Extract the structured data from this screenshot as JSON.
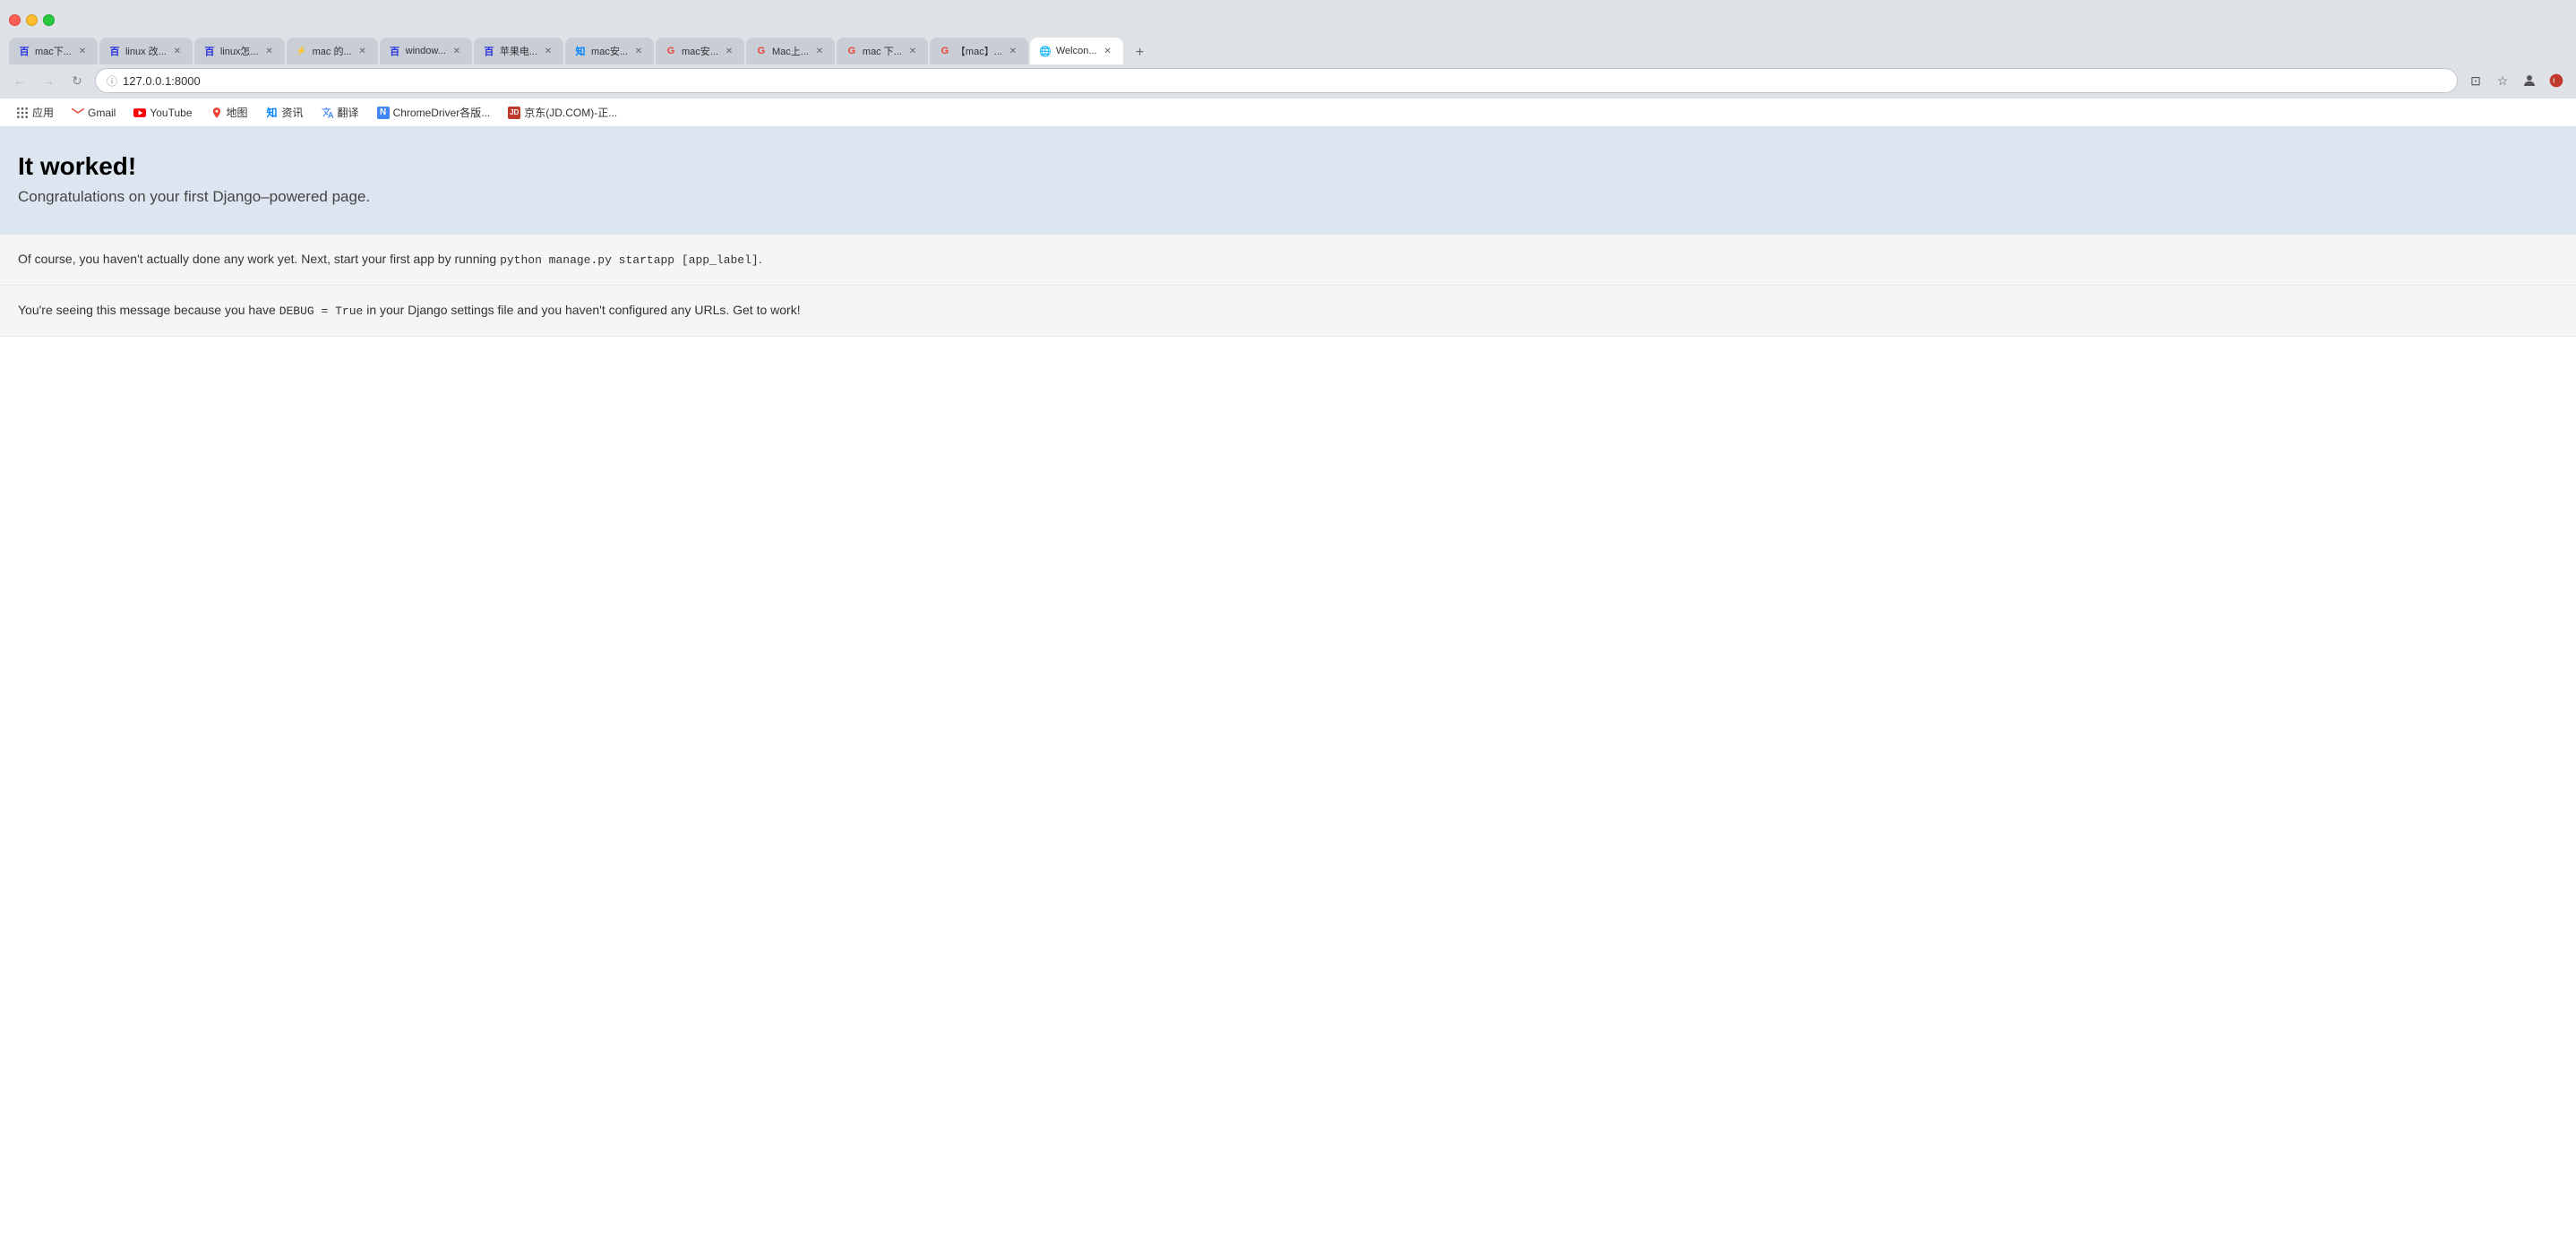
{
  "browser": {
    "url": "127.0.0.1:8000",
    "tabs": [
      {
        "id": "tab1",
        "label": "mac下...",
        "favicon_type": "baidu",
        "favicon_char": "百",
        "active": false
      },
      {
        "id": "tab2",
        "label": "linux 改...",
        "favicon_type": "baidu",
        "favicon_char": "百",
        "active": false
      },
      {
        "id": "tab3",
        "label": "linux怎...",
        "favicon_type": "baidu",
        "favicon_char": "百",
        "active": false
      },
      {
        "id": "tab4",
        "label": "mac 的...",
        "favicon_type": "tab-icon",
        "favicon_char": "⚡",
        "active": false
      },
      {
        "id": "tab5",
        "label": "window...",
        "favicon_type": "baidu",
        "favicon_char": "百",
        "active": false
      },
      {
        "id": "tab6",
        "label": "苹果电...",
        "favicon_type": "baidu",
        "favicon_char": "百",
        "active": false
      },
      {
        "id": "tab7",
        "label": "mac安...",
        "favicon_type": "zhihu",
        "favicon_char": "知",
        "active": false
      },
      {
        "id": "tab8",
        "label": "mac安...",
        "favicon_type": "google-red",
        "favicon_char": "G",
        "active": false
      },
      {
        "id": "tab9",
        "label": "Mac上...",
        "favicon_type": "google-red",
        "favicon_char": "G",
        "active": false
      },
      {
        "id": "tab10",
        "label": "mac 下...",
        "favicon_type": "google-red",
        "favicon_char": "G",
        "active": false
      },
      {
        "id": "tab11",
        "label": "【mac】...",
        "favicon_type": "google-red",
        "favicon_char": "G",
        "active": false
      },
      {
        "id": "tab12",
        "label": "Welcon...",
        "favicon_type": "globe",
        "favicon_char": "🌐",
        "active": true
      }
    ],
    "bookmarks": [
      {
        "label": "应用",
        "favicon_char": "⋮⋮",
        "type": "apps"
      },
      {
        "label": "Gmail",
        "favicon_char": "M",
        "type": "gmail"
      },
      {
        "label": "YouTube",
        "favicon_char": "▶",
        "type": "youtube"
      },
      {
        "label": "地图",
        "favicon_char": "📍",
        "type": "map"
      },
      {
        "label": "资讯",
        "favicon_char": "📰",
        "type": "news"
      },
      {
        "label": "翻译",
        "favicon_char": "🔤",
        "type": "translate"
      },
      {
        "label": "ChromeDriver各版...",
        "favicon_char": "N",
        "type": "chrome"
      },
      {
        "label": "京东(JD.COM)-正...",
        "favicon_char": "JD",
        "type": "jd"
      }
    ]
  },
  "page": {
    "hero_title": "It worked!",
    "hero_subtitle": "Congratulations on your first Django–powered page.",
    "paragraph1_prefix": "Of course, you haven't actually done any work yet. Next, start your first app by running ",
    "paragraph1_code": "python manage.py startapp [app_label]",
    "paragraph1_suffix": ".",
    "paragraph2_prefix": "You're seeing this message because you have ",
    "paragraph2_code1": "DEBUG",
    "paragraph2_code2": " = ",
    "paragraph2_code3": "True",
    "paragraph2_suffix": " in your Django settings file and you haven't configured any URLs. Get to work!"
  },
  "nav": {
    "back_label": "←",
    "forward_label": "→",
    "refresh_label": "↻",
    "new_tab_label": "+"
  }
}
